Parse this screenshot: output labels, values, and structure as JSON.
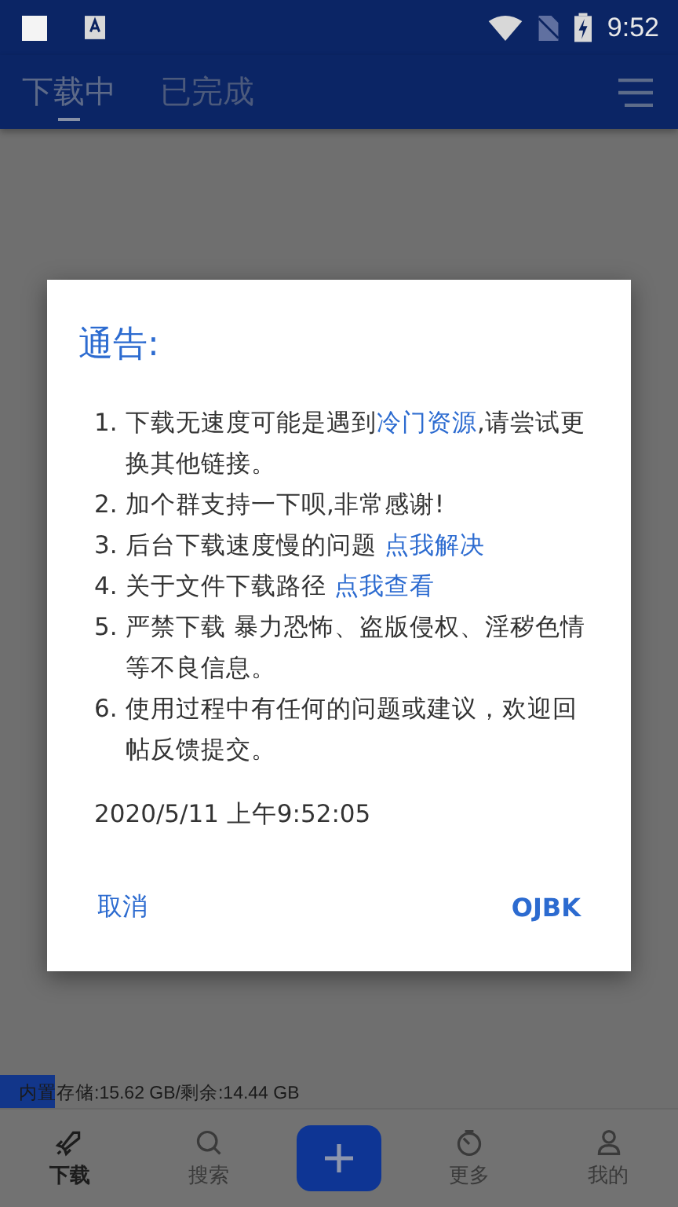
{
  "status_bar": {
    "time": "9:52"
  },
  "tabs": [
    {
      "label": "下载中",
      "selected": true
    },
    {
      "label": "已完成",
      "selected": false
    }
  ],
  "storage": {
    "text": "内置存储:15.62 GB/剩余:14.44 GB",
    "level": 0.08
  },
  "nav": [
    {
      "label": "下载",
      "selected": true
    },
    {
      "label": "搜索",
      "selected": false
    },
    {
      "kind": "add"
    },
    {
      "label": "更多",
      "selected": false
    },
    {
      "label": "我的",
      "selected": false
    }
  ],
  "dialog": {
    "title": "通告:",
    "items": [
      {
        "number": "1.",
        "parts": [
          {
            "text": "下载无速度可能是遇到",
            "link": false
          },
          {
            "text": "冷门资源",
            "link": true
          },
          {
            "text": ",请尝试更换其他链接。",
            "link": false
          }
        ]
      },
      {
        "number": "2.",
        "parts": [
          {
            "text": "加个群支持一下呗,非常感谢!",
            "link": false
          }
        ]
      },
      {
        "number": "3.",
        "parts": [
          {
            "text": "后台下载速度慢的问题 ",
            "link": false
          },
          {
            "text": "点我解决",
            "link": true
          }
        ]
      },
      {
        "number": "4.",
        "parts": [
          {
            "text": "关于文件下载路径 ",
            "link": false
          },
          {
            "text": "点我查看",
            "link": true
          }
        ]
      },
      {
        "number": "5.",
        "parts": [
          {
            "text": "严禁下载 暴力恐怖、盗版侵权、淫秽色情等不良信息。",
            "link": false
          }
        ]
      },
      {
        "number": "6.",
        "parts": [
          {
            "text": "使用过程中有任何的问题或建议，欢迎回帖反馈提交。",
            "link": false
          }
        ]
      }
    ],
    "timestamp": "2020/5/11 上午9:52:05",
    "buttons": [
      "取消",
      "OJBK"
    ]
  }
}
